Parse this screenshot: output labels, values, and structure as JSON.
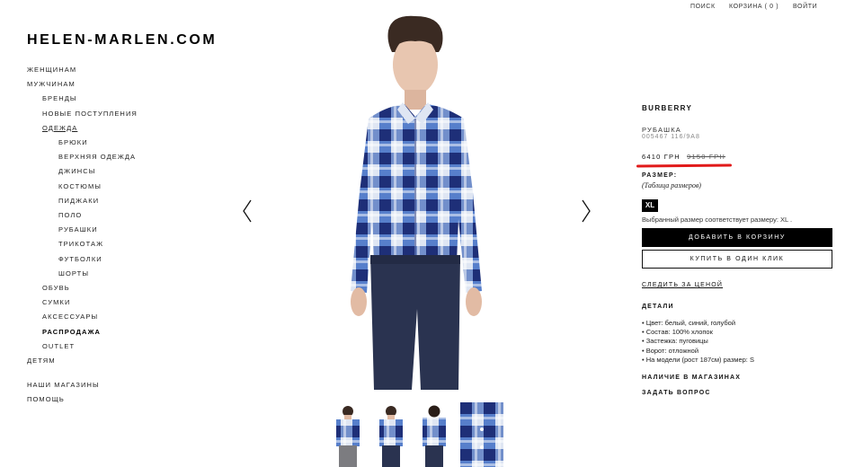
{
  "topbar": {
    "search": "ПОИСК",
    "cart": "КОРЗИНА ( 0 )",
    "login": "ВОЙТИ"
  },
  "logo": "HELEN-MARLEN.COM",
  "nav": [
    {
      "label": "ЖЕНЩИНАМ",
      "level": 0
    },
    {
      "label": "МУЖЧИНАМ",
      "level": 0
    },
    {
      "label": "БРЕНДЫ",
      "level": 1
    },
    {
      "label": "НОВЫЕ ПОСТУПЛЕНИЯ",
      "level": 1
    },
    {
      "label": "ОДЕЖДА",
      "level": 1,
      "active": true
    },
    {
      "label": "БРЮКИ",
      "level": 2
    },
    {
      "label": "ВЕРХНЯЯ ОДЕЖДА",
      "level": 2
    },
    {
      "label": "ДЖИНСЫ",
      "level": 2
    },
    {
      "label": "КОСТЮМЫ",
      "level": 2
    },
    {
      "label": "ПИДЖАКИ",
      "level": 2
    },
    {
      "label": "ПОЛО",
      "level": 2
    },
    {
      "label": "РУБАШКИ",
      "level": 2
    },
    {
      "label": "ТРИКОТАЖ",
      "level": 2
    },
    {
      "label": "ФУТБОЛКИ",
      "level": 2
    },
    {
      "label": "ШОРТЫ",
      "level": 2
    },
    {
      "label": "ОБУВЬ",
      "level": 1
    },
    {
      "label": "СУМКИ",
      "level": 1
    },
    {
      "label": "АКСЕССУАРЫ",
      "level": 1
    },
    {
      "label": "РАСПРОДАЖА",
      "level": 1,
      "bold": true
    },
    {
      "label": "OUTLET",
      "level": 1
    },
    {
      "label": "ДЕТЯМ",
      "level": 0
    },
    {
      "label": "НАШИ МАГАЗИНЫ",
      "level": 0,
      "gap": true
    },
    {
      "label": "ПОМОЩЬ",
      "level": 0
    }
  ],
  "product": {
    "brand": "BURBERRY",
    "type": "РУБАШКА",
    "sku": "005467 116/9A8",
    "price": "6410 ГРН",
    "old_price": "9150 ГРН",
    "size_label": "РАЗМЕР:",
    "size_table": "(Таблица размеров)",
    "size": "XL",
    "size_note": "Выбранный размер соответствует размеру: XL .",
    "add_to_cart": "ДОБАВИТЬ В КОРЗИНУ",
    "one_click": "КУПИТЬ В ОДИН КЛИК",
    "follow_price": "СЛЕДИТЬ ЗА ЦЕНОЙ",
    "details_title": "ДЕТАЛИ",
    "details": [
      "• Цвет: белый, синий, голубой",
      "• Состав: 100% хлопок",
      "• Застежка: пуговицы",
      "• Ворот: отложной",
      "• На модели (рост 187см) размер: S"
    ],
    "stores": "НАЛИЧИЕ В МАГАЗИНАХ",
    "ask": "ЗАДАТЬ ВОПРОС"
  },
  "colors": {
    "accent_red": "#e11a1a",
    "shirt_blue": "#2f5fb8",
    "shirt_navy": "#1e2f78",
    "jeans": "#2a3350"
  },
  "icons": {
    "prev": "chevron-left-icon",
    "next": "chevron-right-icon"
  },
  "thumbnails": [
    {
      "name": "front-grey-pants"
    },
    {
      "name": "front-jeans"
    },
    {
      "name": "back-view"
    },
    {
      "name": "fabric-closeup"
    }
  ]
}
